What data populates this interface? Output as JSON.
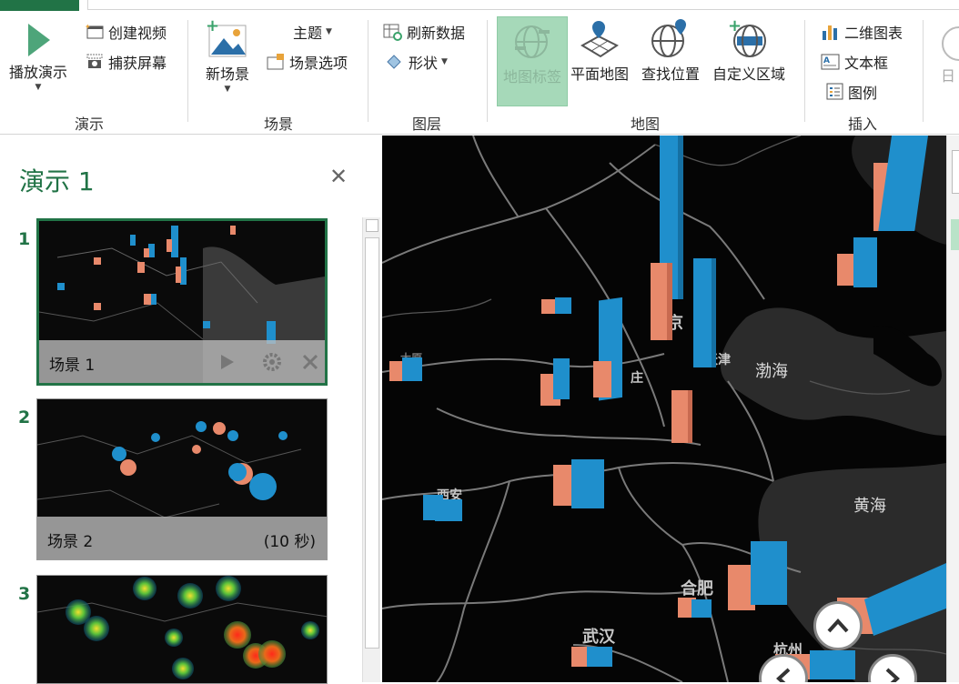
{
  "ribbon": {
    "groups": {
      "tour": {
        "label": "演示",
        "play_tour": "播放演示",
        "create_video": "创建视频",
        "capture_screen": "捕获屏幕"
      },
      "scene": {
        "label": "场景",
        "new_scene": "新场景",
        "themes": "主题",
        "scene_options": "场景选项"
      },
      "layer": {
        "label": "图层",
        "refresh_data": "刷新数据",
        "shapes": "形状"
      },
      "map": {
        "label": "地图",
        "map_labels": "地图标签",
        "flat_map": "平面地图",
        "find_location": "查找位置",
        "custom_regions": "自定义区域"
      },
      "insert": {
        "label": "插入",
        "chart_2d": "二维图表",
        "text_box": "文本框",
        "legend": "图例",
        "partial_next": "日"
      }
    }
  },
  "tour_pane": {
    "title": "演示 1",
    "scenes": [
      {
        "number": "1",
        "name": "场景 1",
        "duration": ""
      },
      {
        "number": "2",
        "name": "场景 2",
        "duration": "(10 秒)"
      },
      {
        "number": "3",
        "name": "",
        "duration": ""
      }
    ]
  },
  "map": {
    "labels": {
      "beijing": "北京",
      "tianjin": "天津",
      "bohai": "渤海",
      "yellow_sea": "黄海",
      "xian": "西安",
      "hefei": "合肥",
      "wuhan": "武汉",
      "hangzhou": "杭州",
      "shijiazhuang_partial": "庄",
      "taiyuan_partial": "太原"
    }
  },
  "colors": {
    "accent": "#217346",
    "bar_blue": "#1f8fcc",
    "bar_salmon": "#e8896b",
    "map_land": "#050505",
    "map_sea": "#2b2b2b"
  }
}
